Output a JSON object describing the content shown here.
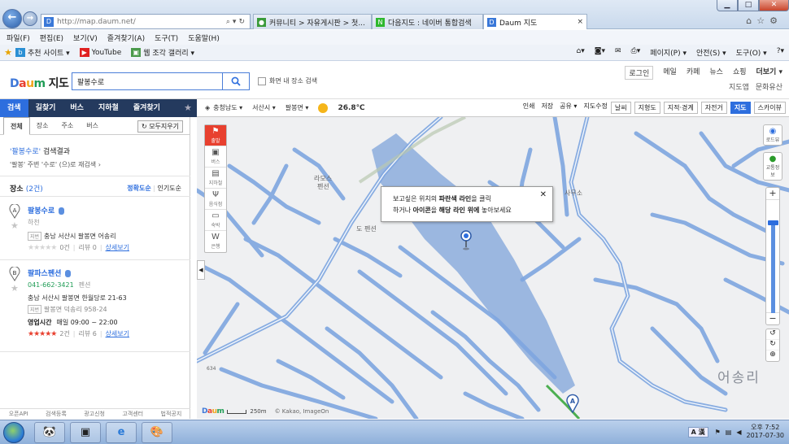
{
  "browser": {
    "url": "http://map.daum.net/",
    "tabs": [
      {
        "label": "커뮤니티 > 자유게시판 > 첫...",
        "color": "#3a9a3a"
      },
      {
        "label": "다음지도 : 네이버 통합검색",
        "color": "#2eb82e"
      },
      {
        "label": "Daum 지도",
        "color": "#3a78d8"
      }
    ],
    "menu": [
      "파일(F)",
      "편집(E)",
      "보기(V)",
      "즐겨찾기(A)",
      "도구(T)",
      "도움말(H)"
    ],
    "favorites": [
      "추천 사이트 ▾",
      "YouTube",
      "웹 조각 갤러리 ▾"
    ],
    "commands": [
      "페이지(P) ▾",
      "안전(S) ▾",
      "도구(O) ▾"
    ]
  },
  "header": {
    "logo_letters": [
      "D",
      "a",
      "u",
      "m"
    ],
    "logo_sub": "지도",
    "search_value": "팔봉수로",
    "checkbox_label": "화면 내 장소 검색",
    "login": "로그인",
    "links": [
      "메일",
      "카페",
      "뉴스",
      "쇼핑",
      "더보기 ▾"
    ],
    "links2": [
      "지도앱",
      "문화유산"
    ]
  },
  "nav": {
    "items": [
      "검색",
      "길찾기",
      "버스",
      "지하철",
      "즐겨찾기"
    ]
  },
  "left": {
    "subtabs": [
      "전체",
      "장소",
      "주소",
      "버스"
    ],
    "clear_button": "모두지우기",
    "result_query": "'팔봉수로'",
    "result_suffix": " 검색결과",
    "related": "'팔봉' 주변 '수로' (으)로 재검색 ›",
    "places_label": "장소",
    "places_count": "(2건)",
    "sort_on": "정확도순",
    "sort_off": "인기도순",
    "entries": [
      {
        "marker": "A",
        "name": "팔봉수로",
        "category": "하천",
        "jibun_tag": "지번",
        "address": "충남 서산시 팔봉면 어송리",
        "reviews": "0건",
        "review_count": "리뷰 0",
        "detail": "상세보기"
      },
      {
        "marker": "B",
        "name": "팔파스펜션",
        "phone": "041-662-3421",
        "category": "펜션",
        "address": "충남 서산시 팔봉면 한월당로 21-63",
        "jibun_tag": "지번",
        "jibun": "팔봉면 덕송리 958-24",
        "hours_label": "영업시간",
        "hours": "매일 09:00 ~ 22:00",
        "reviews": "2건",
        "review_count": "리뷰 6",
        "detail": "상세보기"
      }
    ],
    "footer": [
      "오픈API",
      "검색등록",
      "광고신청",
      "고객센터",
      "법적공지"
    ]
  },
  "maptoolbar": {
    "region": [
      "충청남도 ▾",
      "서산시 ▾",
      "팔봉면 ▾"
    ],
    "temperature": "26.8℃",
    "tools": [
      "인쇄",
      "저장",
      "공유 ▾",
      "지도수정"
    ],
    "buttons": [
      "날씨",
      "지형도",
      "지적·경계",
      "자전거",
      "지도",
      "스카이뷰"
    ]
  },
  "map": {
    "leftbar": [
      {
        "label": "출발",
        "icon": "⚑"
      },
      {
        "label": "버스",
        "icon": "🚌"
      },
      {
        "label": "지하철",
        "icon": "🚇"
      },
      {
        "label": "음식점",
        "icon": "🍴"
      },
      {
        "label": "숙박",
        "icon": "🛏"
      },
      {
        "label": "은행",
        "icon": "W"
      }
    ],
    "rightbar": [
      "로드뷰",
      "교통정보"
    ],
    "tooltip_line1_pre": "보고싶은 위치의 ",
    "tooltip_line1_b": "파란색 라인",
    "tooltip_line1_post": "을 클릭",
    "tooltip_line2_pre": "하거나 ",
    "tooltip_line2_b1": "아이콘",
    "tooltip_line2_mid": "을 ",
    "tooltip_line2_b2": "해당 라인 위에",
    "tooltip_line2_post": " 놓아보세요",
    "labels": [
      "라모스",
      "펜션",
      "도",
      "펜션",
      "사무소"
    ],
    "big_place": "어송리",
    "route_number": "634",
    "scale_label": "250m",
    "copyright": "© Kakao, ImageOn",
    "marker": "A"
  },
  "taskbar": {
    "ime": "A 漢",
    "time": "오후 7:52",
    "date": "2017-07-30"
  }
}
